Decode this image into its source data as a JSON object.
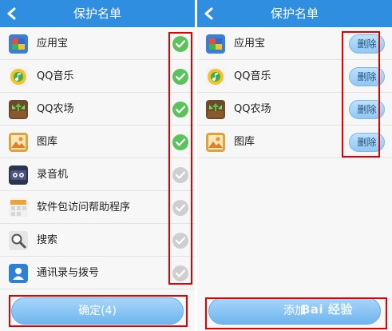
{
  "left_screen": {
    "title": "保护名单",
    "apps": [
      {
        "label": "应用宝",
        "icon": "yingyongbao-icon",
        "checked": true
      },
      {
        "label": "QQ音乐",
        "icon": "qq-music-icon",
        "checked": true
      },
      {
        "label": "QQ农场",
        "icon": "qq-farm-icon",
        "checked": true
      },
      {
        "label": "图库",
        "icon": "gallery-icon",
        "checked": true
      },
      {
        "label": "录音机",
        "icon": "recorder-icon",
        "checked": false
      },
      {
        "label": "软件包访问帮助程序",
        "icon": "package-helper-icon",
        "checked": false
      },
      {
        "label": "搜索",
        "icon": "search-icon",
        "checked": false
      },
      {
        "label": "通讯录与拨号",
        "icon": "contacts-icon",
        "checked": false
      }
    ],
    "confirm_label": "确定(4)"
  },
  "right_screen": {
    "title": "保护名单",
    "apps": [
      {
        "label": "应用宝",
        "icon": "yingyongbao-icon",
        "delete_label": "删除"
      },
      {
        "label": "QQ音乐",
        "icon": "qq-music-icon",
        "delete_label": "删除"
      },
      {
        "label": "QQ农场",
        "icon": "qq-farm-icon",
        "delete_label": "删除"
      },
      {
        "label": "图库",
        "icon": "gallery-icon",
        "delete_label": "删除"
      }
    ],
    "add_label": "添加"
  },
  "watermark": "Bai 经验",
  "colors": {
    "title_bar": "#2f8ee0",
    "check_on": "#5cc25d",
    "check_off": "#cfcfcf",
    "highlight": "#e00000",
    "button": "#8fc8f3"
  }
}
